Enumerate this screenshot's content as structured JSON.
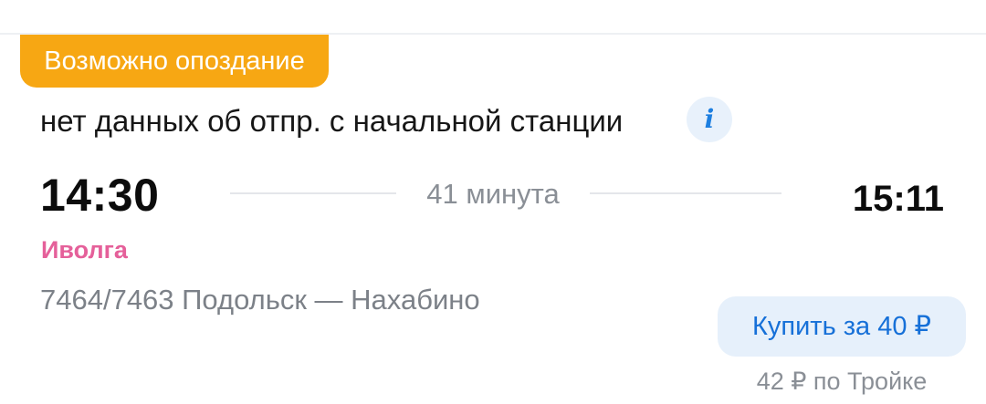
{
  "trip": {
    "delay_badge": "Возможно опоздание",
    "departure_note": "нет данных об отпр. с начальной станции",
    "info_icon": "i",
    "departure_time": "14:30",
    "duration": "41 минута",
    "arrival_time": "15:11",
    "train_brand": "Иволга",
    "route": "7464/7463 Подольск — Нахабино",
    "buy_label": "Купить за 40 ₽",
    "troika_price": "42 ₽ по Тройке"
  },
  "colors": {
    "badge": "#f7a713",
    "brand": "#e5609a",
    "accent": "#1670d8",
    "button_bg": "#e6f0fb",
    "muted": "#8a8f96"
  }
}
